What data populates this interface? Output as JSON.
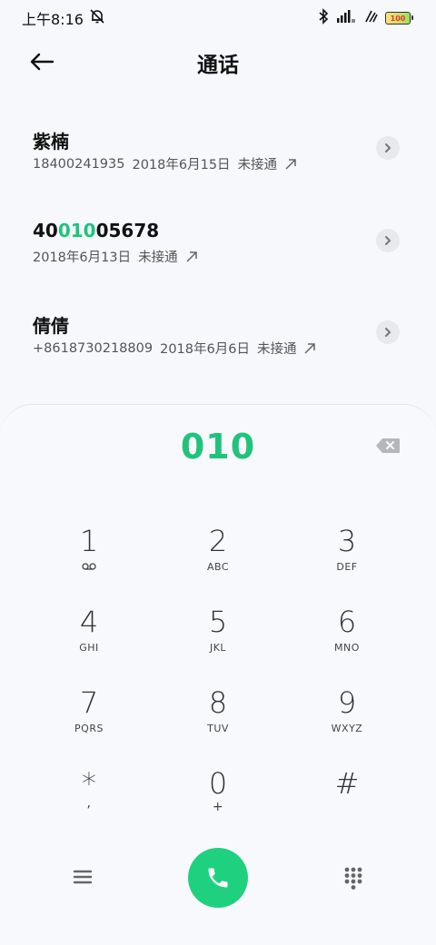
{
  "status_bar": {
    "time": "上午8:16",
    "battery": "100"
  },
  "header": {
    "title": "通话"
  },
  "calls": [
    {
      "name": "紫楠",
      "number": "18400241935",
      "date": "2018年6月15日",
      "status": "未接通"
    },
    {
      "name_parts": [
        "40",
        "010",
        "05678"
      ],
      "date": "2018年6月13日",
      "status": "未接通"
    },
    {
      "name": "倩倩",
      "number": "+8618730218809",
      "date": "2018年6月6日",
      "status": "未接通"
    }
  ],
  "dialer": {
    "input": "010",
    "keys": [
      {
        "digit": "1",
        "letters": ""
      },
      {
        "digit": "2",
        "letters": "ABC"
      },
      {
        "digit": "3",
        "letters": "DEF"
      },
      {
        "digit": "4",
        "letters": "GHI"
      },
      {
        "digit": "5",
        "letters": "JKL"
      },
      {
        "digit": "6",
        "letters": "MNO"
      },
      {
        "digit": "7",
        "letters": "PQRS"
      },
      {
        "digit": "8",
        "letters": "TUV"
      },
      {
        "digit": "9",
        "letters": "WXYZ"
      },
      {
        "digit": "*",
        "letters": ","
      },
      {
        "digit": "0",
        "letters": "+"
      },
      {
        "digit": "#",
        "letters": ""
      }
    ]
  },
  "colors": {
    "accent": "#1fc47a",
    "call_button": "#1fd17f"
  }
}
